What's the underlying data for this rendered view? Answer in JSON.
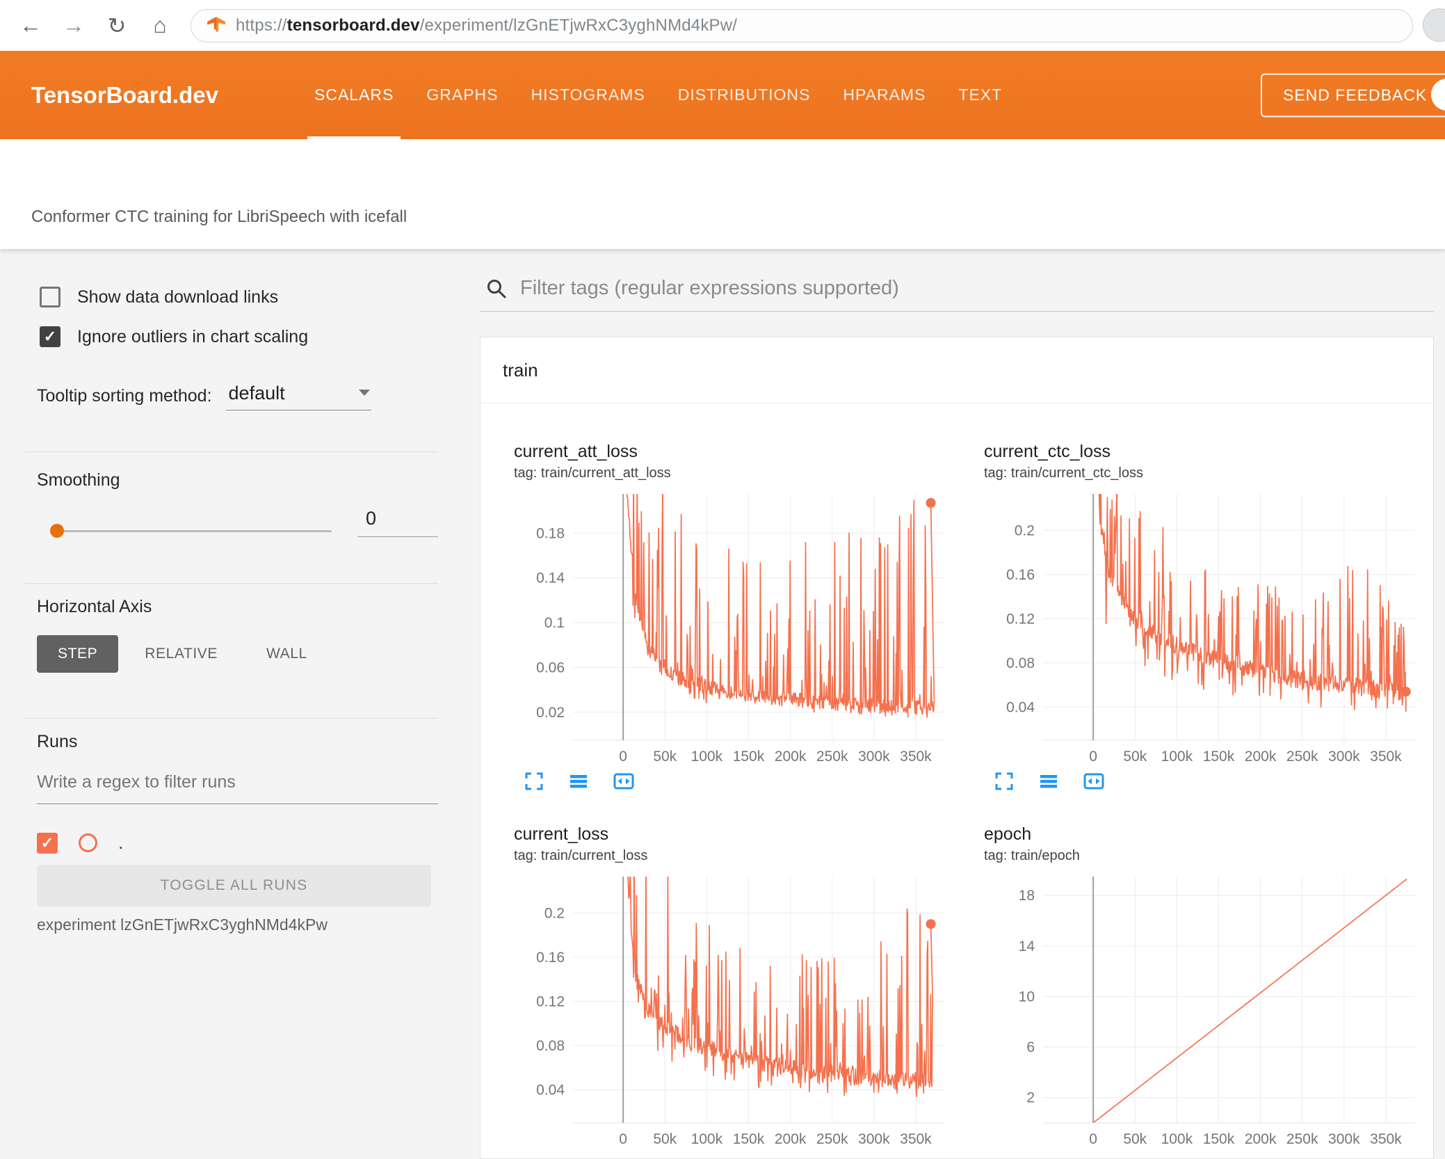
{
  "colors": {
    "accent_orange": "#f4714e",
    "header_orange": "#ee7220",
    "icon_blue": "#2196f3",
    "slider_orange": "#e8710a"
  },
  "icons": {
    "back": "←",
    "forward": "→",
    "refresh": "↻",
    "home": "⌂",
    "check": "✓"
  },
  "browser": {
    "url_prefix": "https://",
    "url_domain": "tensorboard.dev",
    "url_path": "/experiment/lzGnETjwRxC3yghNMd4kPw/"
  },
  "header": {
    "brand": "TensorBoard.dev",
    "tabs": [
      {
        "label": "SCALARS",
        "active": true
      },
      {
        "label": "GRAPHS",
        "active": false
      },
      {
        "label": "HISTOGRAMS",
        "active": false
      },
      {
        "label": "DISTRIBUTIONS",
        "active": false
      },
      {
        "label": "HPARAMS",
        "active": false
      },
      {
        "label": "TEXT",
        "active": false
      }
    ],
    "feedback_label": "SEND FEEDBACK"
  },
  "experiment_title": "Conformer CTC training for LibriSpeech with icefall",
  "sidebar": {
    "show_download": {
      "label": "Show data download links",
      "checked": false
    },
    "ignore_outliers": {
      "label": "Ignore outliers in chart scaling",
      "checked": true
    },
    "tooltip_sorting": {
      "label": "Tooltip sorting method:",
      "value": "default"
    },
    "smoothing": {
      "label": "Smoothing",
      "value": "0"
    },
    "horizontal_axis": {
      "label": "Horizontal Axis",
      "options": [
        "STEP",
        "RELATIVE",
        "WALL"
      ],
      "selected": "STEP"
    },
    "runs": {
      "label": "Runs",
      "filter_placeholder": "Write a regex to filter runs",
      "run_label": ".",
      "toggle_button": "TOGGLE ALL RUNS",
      "experiment_caption": "experiment lzGnETjwRxC3yghNMd4kPw"
    }
  },
  "main": {
    "filter_placeholder": "Filter tags (regular expressions supported)",
    "group_title": "train"
  },
  "chart_data": [
    {
      "type": "line",
      "title": "current_att_loss",
      "subtitle": "tag: train/current_att_loss",
      "series": "train",
      "color": "#f4714e",
      "xlim": [
        -60000,
        385000
      ],
      "ylim": [
        -0.005,
        0.215
      ],
      "x_ticks": [
        {
          "v": 0,
          "label": "0"
        },
        {
          "v": 50000,
          "label": "50k"
        },
        {
          "v": 100000,
          "label": "100k"
        },
        {
          "v": 150000,
          "label": "150k"
        },
        {
          "v": 200000,
          "label": "200k"
        },
        {
          "v": 250000,
          "label": "250k"
        },
        {
          "v": 300000,
          "label": "300k"
        },
        {
          "v": 350000,
          "label": "350k"
        }
      ],
      "y_ticks": [
        {
          "v": 0.02,
          "label": "0.02"
        },
        {
          "v": 0.06,
          "label": "0.06"
        },
        {
          "v": 0.1,
          "label": "0.1"
        },
        {
          "v": 0.14,
          "label": "0.14"
        },
        {
          "v": 0.18,
          "label": "0.18"
        }
      ],
      "noisy": true,
      "seed": 11,
      "n_points": 520,
      "spike_prob": 0.26,
      "dip_prob": 0.12,
      "jitter": 0.013,
      "x_data_range": [
        2500,
        372000
      ],
      "baseline": [
        [
          2500,
          0.24
        ],
        [
          8000,
          0.18
        ],
        [
          15000,
          0.12
        ],
        [
          30000,
          0.075
        ],
        [
          50000,
          0.055
        ],
        [
          80000,
          0.045
        ],
        [
          120000,
          0.038
        ],
        [
          160000,
          0.033
        ],
        [
          200000,
          0.03
        ],
        [
          250000,
          0.027
        ],
        [
          300000,
          0.025
        ],
        [
          372000,
          0.023
        ]
      ],
      "spike_top": [
        [
          2500,
          0.3
        ],
        [
          30000,
          0.24
        ],
        [
          80000,
          0.19
        ],
        [
          150000,
          0.165
        ],
        [
          250000,
          0.175
        ],
        [
          330000,
          0.21
        ],
        [
          372000,
          0.215
        ]
      ],
      "end_dot": {
        "x": 368000,
        "y": 0.207
      },
      "toolbar": true
    },
    {
      "type": "line",
      "title": "current_ctc_loss",
      "subtitle": "tag: train/current_ctc_loss",
      "series": "train",
      "color": "#f4714e",
      "xlim": [
        -60000,
        385000
      ],
      "ylim": [
        0.01,
        0.233
      ],
      "x_ticks": [
        {
          "v": 0,
          "label": "0"
        },
        {
          "v": 50000,
          "label": "50k"
        },
        {
          "v": 100000,
          "label": "100k"
        },
        {
          "v": 150000,
          "label": "150k"
        },
        {
          "v": 200000,
          "label": "200k"
        },
        {
          "v": 250000,
          "label": "250k"
        },
        {
          "v": 300000,
          "label": "300k"
        },
        {
          "v": 350000,
          "label": "350k"
        }
      ],
      "y_ticks": [
        {
          "v": 0.04,
          "label": "0.04"
        },
        {
          "v": 0.08,
          "label": "0.08"
        },
        {
          "v": 0.12,
          "label": "0.12"
        },
        {
          "v": 0.16,
          "label": "0.16"
        },
        {
          "v": 0.2,
          "label": "0.2"
        }
      ],
      "noisy": true,
      "seed": 23,
      "n_points": 520,
      "spike_prob": 0.25,
      "dip_prob": 0.14,
      "jitter": 0.016,
      "x_data_range": [
        2500,
        374000
      ],
      "baseline": [
        [
          2500,
          0.26
        ],
        [
          8000,
          0.21
        ],
        [
          15000,
          0.17
        ],
        [
          30000,
          0.14
        ],
        [
          50000,
          0.118
        ],
        [
          80000,
          0.1
        ],
        [
          120000,
          0.088
        ],
        [
          160000,
          0.078
        ],
        [
          200000,
          0.07
        ],
        [
          250000,
          0.063
        ],
        [
          300000,
          0.058
        ],
        [
          374000,
          0.052
        ]
      ],
      "spike_top": [
        [
          2500,
          0.3
        ],
        [
          30000,
          0.26
        ],
        [
          80000,
          0.21
        ],
        [
          150000,
          0.16
        ],
        [
          250000,
          0.145
        ],
        [
          320000,
          0.175
        ],
        [
          374000,
          0.135
        ]
      ],
      "end_dot": {
        "x": 374000,
        "y": 0.054
      },
      "toolbar": true
    },
    {
      "type": "line",
      "title": "current_loss",
      "subtitle": "tag: train/current_loss",
      "series": "train",
      "color": "#f4714e",
      "xlim": [
        -60000,
        385000
      ],
      "ylim": [
        0.01,
        0.233
      ],
      "x_ticks": [
        {
          "v": 0,
          "label": "0"
        },
        {
          "v": 50000,
          "label": "50k"
        },
        {
          "v": 100000,
          "label": "100k"
        },
        {
          "v": 150000,
          "label": "150k"
        },
        {
          "v": 200000,
          "label": "200k"
        },
        {
          "v": 250000,
          "label": "250k"
        },
        {
          "v": 300000,
          "label": "300k"
        },
        {
          "v": 350000,
          "label": "350k"
        }
      ],
      "y_ticks": [
        {
          "v": 0.04,
          "label": "0.04"
        },
        {
          "v": 0.08,
          "label": "0.08"
        },
        {
          "v": 0.12,
          "label": "0.12"
        },
        {
          "v": 0.16,
          "label": "0.16"
        },
        {
          "v": 0.2,
          "label": "0.2"
        }
      ],
      "noisy": true,
      "seed": 37,
      "n_points": 520,
      "spike_prob": 0.25,
      "dip_prob": 0.13,
      "jitter": 0.015,
      "x_data_range": [
        2500,
        370000
      ],
      "baseline": [
        [
          2500,
          0.27
        ],
        [
          8000,
          0.2
        ],
        [
          15000,
          0.14
        ],
        [
          30000,
          0.11
        ],
        [
          50000,
          0.095
        ],
        [
          80000,
          0.082
        ],
        [
          120000,
          0.072
        ],
        [
          160000,
          0.064
        ],
        [
          200000,
          0.058
        ],
        [
          250000,
          0.053
        ],
        [
          300000,
          0.049
        ],
        [
          370000,
          0.046
        ]
      ],
      "spike_top": [
        [
          2500,
          0.3
        ],
        [
          30000,
          0.26
        ],
        [
          80000,
          0.21
        ],
        [
          150000,
          0.17
        ],
        [
          250000,
          0.16
        ],
        [
          320000,
          0.2
        ],
        [
          370000,
          0.21
        ]
      ],
      "end_dot": {
        "x": 368000,
        "y": 0.19
      },
      "toolbar": false
    },
    {
      "type": "line",
      "title": "epoch",
      "subtitle": "tag: train/epoch",
      "series": "train",
      "color": "#f4714e",
      "xlim": [
        -60000,
        385000
      ],
      "ylim": [
        0,
        19.5
      ],
      "x_ticks": [
        {
          "v": 0,
          "label": "0"
        },
        {
          "v": 50000,
          "label": "50k"
        },
        {
          "v": 100000,
          "label": "100k"
        },
        {
          "v": 150000,
          "label": "150k"
        },
        {
          "v": 200000,
          "label": "200k"
        },
        {
          "v": 250000,
          "label": "250k"
        },
        {
          "v": 300000,
          "label": "300k"
        },
        {
          "v": 350000,
          "label": "350k"
        }
      ],
      "y_ticks": [
        {
          "v": 2,
          "label": "2"
        },
        {
          "v": 6,
          "label": "6"
        },
        {
          "v": 10,
          "label": "10"
        },
        {
          "v": 14,
          "label": "14"
        },
        {
          "v": 18,
          "label": "18"
        }
      ],
      "noisy": false,
      "points": [
        [
          1000,
          0.05
        ],
        [
          375000,
          19.3
        ]
      ],
      "toolbar": false
    }
  ]
}
